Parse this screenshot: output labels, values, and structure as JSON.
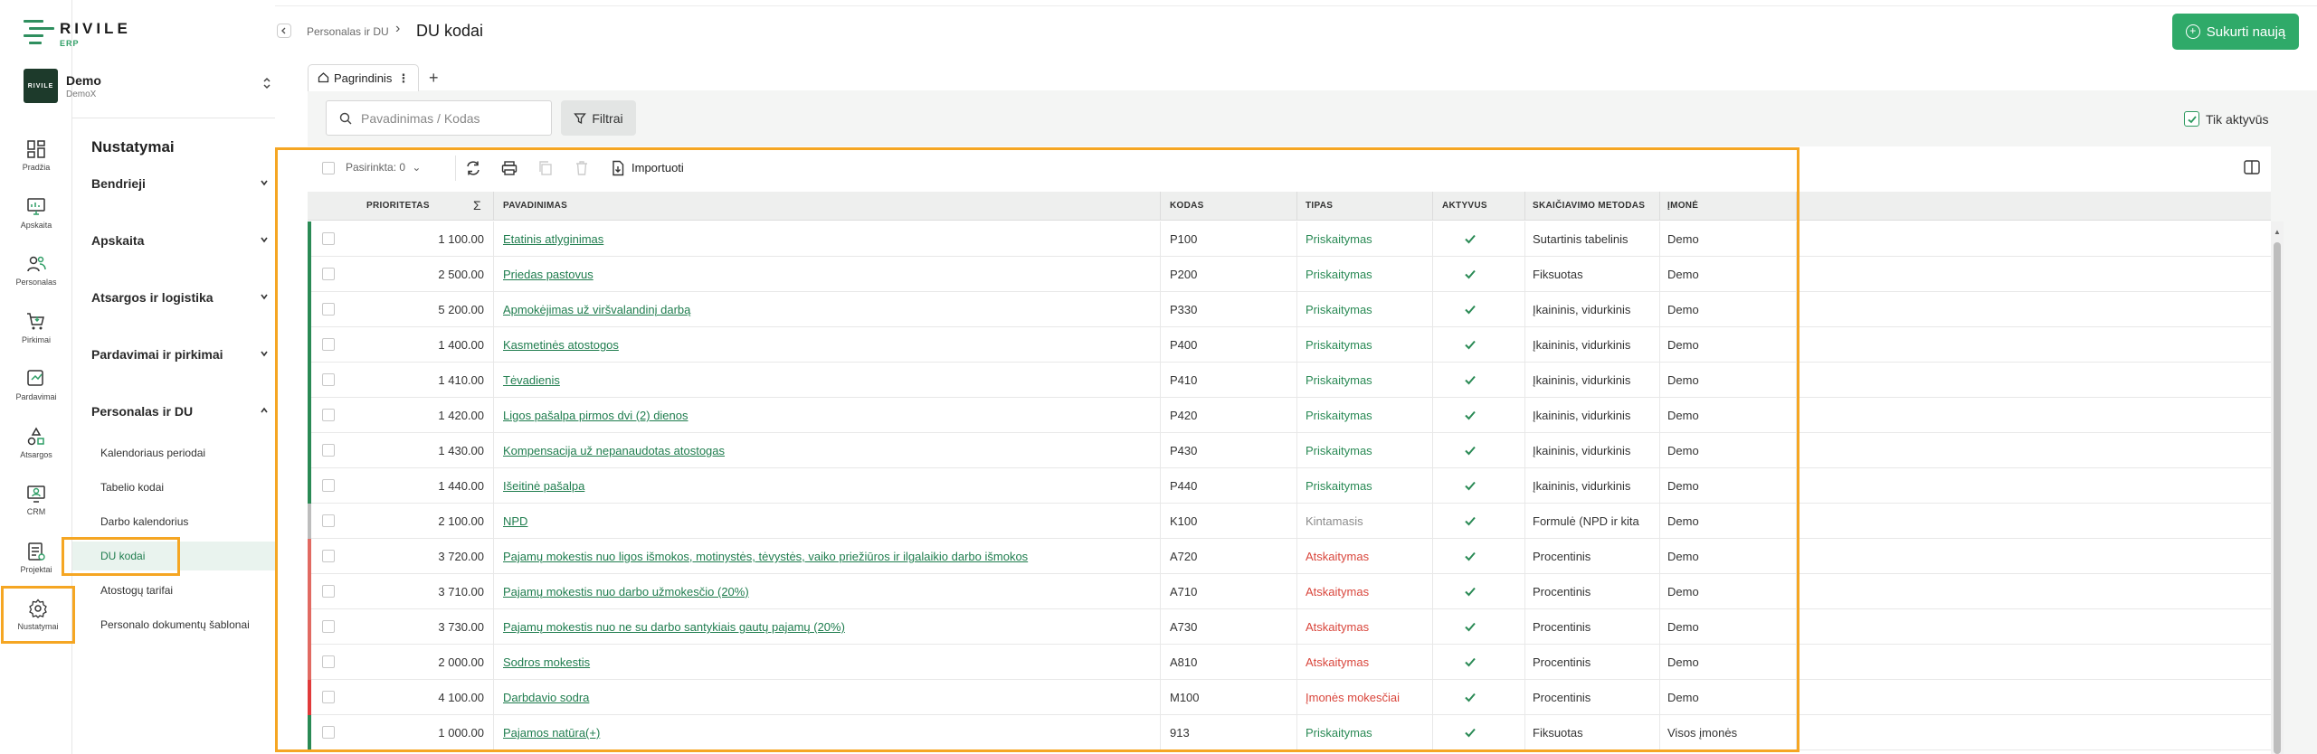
{
  "brand": {
    "name": "RIVILE",
    "sub": "ERP",
    "color": "#2faa69"
  },
  "company": {
    "name": "Demo",
    "sub": "DemoX",
    "logo_text": "RIVILE"
  },
  "rail": [
    {
      "label": "Pradžia",
      "icon": "dashboard-icon"
    },
    {
      "label": "Apskaita",
      "icon": "chart-monitor-icon"
    },
    {
      "label": "Personalas",
      "icon": "people-icon"
    },
    {
      "label": "Pirkimai",
      "icon": "cart-icon"
    },
    {
      "label": "Pardavimai",
      "icon": "sales-icon"
    },
    {
      "label": "Atsargos",
      "icon": "shapes-icon"
    },
    {
      "label": "CRM",
      "icon": "crm-icon"
    },
    {
      "label": "Projektai",
      "icon": "projects-icon"
    },
    {
      "label": "Nustatymai",
      "icon": "gear-icon"
    }
  ],
  "submenu": {
    "title": "Nustatymai",
    "sections": [
      {
        "label": "Bendrieji"
      },
      {
        "label": "Apskaita"
      },
      {
        "label": "Atsargos ir logistika"
      },
      {
        "label": "Pardavimai ir pirkimai"
      },
      {
        "label": "Personalas ir DU"
      }
    ],
    "links": [
      {
        "label": "Kalendoriaus periodai"
      },
      {
        "label": "Tabelio kodai"
      },
      {
        "label": "Darbo kalendorius"
      },
      {
        "label": "DU kodai"
      },
      {
        "label": "Atostogų tarifai"
      },
      {
        "label": "Personalo dokumentų šablonai"
      }
    ]
  },
  "header": {
    "breadcrumb": "Personalas ir DU",
    "title": "DU kodai",
    "create_label": "Sukurti naują"
  },
  "tabs": {
    "main": "Pagrindinis"
  },
  "filters": {
    "search_placeholder": "Pavadinimas / Kodas",
    "filter_label": "Filtrai",
    "only_active_label": "Tik aktyvūs"
  },
  "toolbar": {
    "selected_label": "Pasirinkta: 0",
    "import_label": "Importuoti"
  },
  "columns": {
    "priority": "PRIORITETAS",
    "name": "PAVADINIMAS",
    "code": "KODAS",
    "type": "TIPAS",
    "active": "AKTYVUS",
    "method": "SKAIČIAVIMO METODAS",
    "company": "ĮMONĖ"
  },
  "rows": [
    {
      "priority": "1 100.00",
      "name": "Etatinis atlyginimas",
      "code": "P100",
      "type": "Priskaitymas",
      "kind": "p",
      "method": "Sutartinis tabelinis",
      "company": "Demo"
    },
    {
      "priority": "2 500.00",
      "name": "Priedas pastovus",
      "code": "P200",
      "type": "Priskaitymas",
      "kind": "p",
      "method": "Fiksuotas",
      "company": "Demo"
    },
    {
      "priority": "5 200.00",
      "name": "Apmokėjimas už viršvalandinį darbą",
      "code": "P330",
      "type": "Priskaitymas",
      "kind": "p",
      "method": "Įkaininis, vidurkinis",
      "company": "Demo"
    },
    {
      "priority": "1 400.00",
      "name": "Kasmetinės atostogos",
      "code": "P400",
      "type": "Priskaitymas",
      "kind": "p",
      "method": "Įkaininis, vidurkinis",
      "company": "Demo"
    },
    {
      "priority": "1 410.00",
      "name": "Tėvadienis",
      "code": "P410",
      "type": "Priskaitymas",
      "kind": "p",
      "method": "Įkaininis, vidurkinis",
      "company": "Demo"
    },
    {
      "priority": "1 420.00",
      "name": "Ligos pašalpa pirmos dvi (2) dienos",
      "code": "P420",
      "type": "Priskaitymas",
      "kind": "p",
      "method": "Įkaininis, vidurkinis",
      "company": "Demo"
    },
    {
      "priority": "1 430.00",
      "name": "Kompensacija už nepanaudotas atostogas",
      "code": "P430",
      "type": "Priskaitymas",
      "kind": "p",
      "method": "Įkaininis, vidurkinis",
      "company": "Demo"
    },
    {
      "priority": "1 440.00",
      "name": "Išeitinė pašalpa",
      "code": "P440",
      "type": "Priskaitymas",
      "kind": "p",
      "method": "Įkaininis, vidurkinis",
      "company": "Demo"
    },
    {
      "priority": "2 100.00",
      "name": "NPD",
      "code": "K100",
      "type": "Kintamasis",
      "kind": "k",
      "method": "Formulė (NPD ir kita",
      "company": "Demo"
    },
    {
      "priority": "3 720.00",
      "name": "Pajamų mokestis nuo ligos išmokos, motinystės, tėvystės, vaiko priežiūros ir ilgalaikio darbo išmokos",
      "code": "A720",
      "type": "Atskaitymas",
      "kind": "a",
      "method": "Procentinis",
      "company": "Demo"
    },
    {
      "priority": "3 710.00",
      "name": "Pajamų mokestis nuo darbo užmokesčio (20%)",
      "code": "A710",
      "type": "Atskaitymas",
      "kind": "a",
      "method": "Procentinis",
      "company": "Demo"
    },
    {
      "priority": "3 730.00",
      "name": "Pajamų mokestis nuo ne su darbo santykiais gautų pajamų (20%)",
      "code": "A730",
      "type": "Atskaitymas",
      "kind": "a",
      "method": "Procentinis",
      "company": "Demo"
    },
    {
      "priority": "2 000.00",
      "name": "Sodros mokestis",
      "code": "A810",
      "type": "Atskaitymas",
      "kind": "a",
      "method": "Procentinis",
      "company": "Demo"
    },
    {
      "priority": "4 100.00",
      "name": "Darbdavio sodra",
      "code": "M100",
      "type": "Įmonės mokesčiai",
      "kind": "m",
      "method": "Procentinis",
      "company": "Demo"
    },
    {
      "priority": "1 000.00",
      "name": "Pajamos natūra(+)",
      "code": "913",
      "type": "Priskaitymas",
      "kind": "p",
      "method": "Fiksuotas",
      "company": "Visos įmonės"
    }
  ],
  "colors": {
    "priskaitymas": "#2a8a55",
    "kintamasis": "#aaaaaa",
    "atskaitymas": "#d9463c",
    "imones": "#e03a3a",
    "highlight": "#f5a623"
  }
}
